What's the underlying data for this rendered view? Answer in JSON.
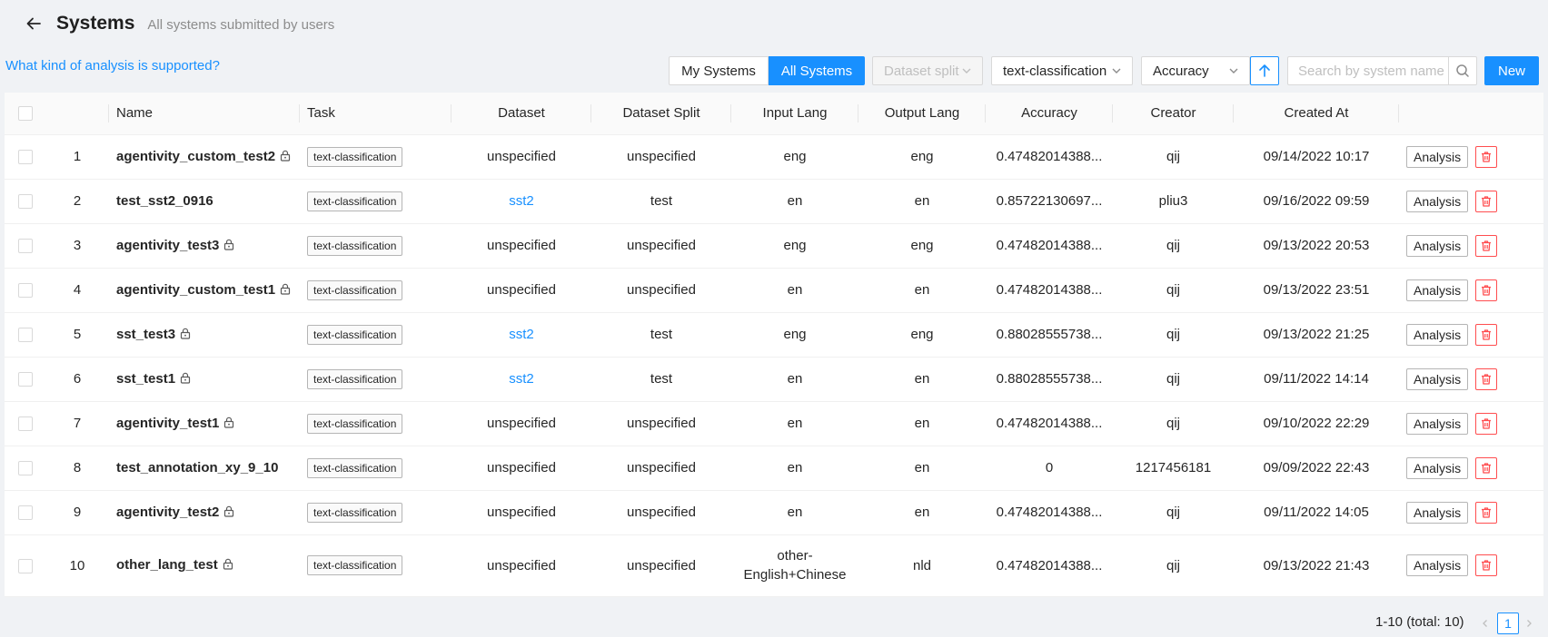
{
  "header": {
    "title": "Systems",
    "subtitle": "All systems submitted by users"
  },
  "help_link": "What kind of analysis is supported?",
  "toolbar": {
    "my_systems": "My Systems",
    "all_systems": "All Systems",
    "dataset_split_placeholder": "Dataset split",
    "task_value": "text-classification",
    "metric_value": "Accuracy",
    "search_placeholder": "Search by system name",
    "new_label": "New"
  },
  "table": {
    "columns": [
      "Name",
      "Task",
      "Dataset",
      "Dataset Split",
      "Input Lang",
      "Output Lang",
      "Accuracy",
      "Creator",
      "Created At"
    ],
    "rows": [
      {
        "index": "1",
        "name": "agentivity_custom_test2",
        "locked": true,
        "task": "text-classification",
        "dataset": "unspecified",
        "dataset_link": false,
        "split": "unspecified",
        "input_lang": "eng",
        "output_lang": "eng",
        "accuracy": "0.47482014388...",
        "creator": "qij",
        "created_at": "09/14/2022 10:17"
      },
      {
        "index": "2",
        "name": "test_sst2_0916",
        "locked": false,
        "task": "text-classification",
        "dataset": "sst2",
        "dataset_link": true,
        "split": "test",
        "input_lang": "en",
        "output_lang": "en",
        "accuracy": "0.85722130697...",
        "creator": "pliu3",
        "created_at": "09/16/2022 09:59"
      },
      {
        "index": "3",
        "name": "agentivity_test3",
        "locked": true,
        "task": "text-classification",
        "dataset": "unspecified",
        "dataset_link": false,
        "split": "unspecified",
        "input_lang": "eng",
        "output_lang": "eng",
        "accuracy": "0.47482014388...",
        "creator": "qij",
        "created_at": "09/13/2022 20:53"
      },
      {
        "index": "4",
        "name": "agentivity_custom_test1",
        "locked": true,
        "task": "text-classification",
        "dataset": "unspecified",
        "dataset_link": false,
        "split": "unspecified",
        "input_lang": "en",
        "output_lang": "en",
        "accuracy": "0.47482014388...",
        "creator": "qij",
        "created_at": "09/13/2022 23:51"
      },
      {
        "index": "5",
        "name": "sst_test3",
        "locked": true,
        "task": "text-classification",
        "dataset": "sst2",
        "dataset_link": true,
        "split": "test",
        "input_lang": "eng",
        "output_lang": "eng",
        "accuracy": "0.88028555738...",
        "creator": "qij",
        "created_at": "09/13/2022 21:25"
      },
      {
        "index": "6",
        "name": "sst_test1",
        "locked": true,
        "task": "text-classification",
        "dataset": "sst2",
        "dataset_link": true,
        "split": "test",
        "input_lang": "en",
        "output_lang": "en",
        "accuracy": "0.88028555738...",
        "creator": "qij",
        "created_at": "09/11/2022 14:14"
      },
      {
        "index": "7",
        "name": "agentivity_test1",
        "locked": true,
        "task": "text-classification",
        "dataset": "unspecified",
        "dataset_link": false,
        "split": "unspecified",
        "input_lang": "en",
        "output_lang": "en",
        "accuracy": "0.47482014388...",
        "creator": "qij",
        "created_at": "09/10/2022 22:29"
      },
      {
        "index": "8",
        "name": "test_annotation_xy_9_10",
        "locked": false,
        "task": "text-classification",
        "dataset": "unspecified",
        "dataset_link": false,
        "split": "unspecified",
        "input_lang": "en",
        "output_lang": "en",
        "accuracy": "0",
        "creator": "1217456181",
        "created_at": "09/09/2022 22:43"
      },
      {
        "index": "9",
        "name": "agentivity_test2",
        "locked": true,
        "task": "text-classification",
        "dataset": "unspecified",
        "dataset_link": false,
        "split": "unspecified",
        "input_lang": "en",
        "output_lang": "en",
        "accuracy": "0.47482014388...",
        "creator": "qij",
        "created_at": "09/11/2022 14:05"
      },
      {
        "index": "10",
        "name": "other_lang_test",
        "locked": true,
        "task": "text-classification",
        "dataset": "unspecified",
        "dataset_link": false,
        "split": "unspecified",
        "input_lang": "other-English+Chinese",
        "input_lang_lines": [
          "other-",
          "English+Chinese"
        ],
        "output_lang": "nld",
        "accuracy": "0.47482014388...",
        "creator": "qij",
        "created_at": "09/13/2022 21:43"
      }
    ],
    "analysis_label": "Analysis"
  },
  "pagination": {
    "total_text": "1-10 (total: 10)",
    "current_page": "1"
  },
  "colors": {
    "primary": "#1890ff",
    "danger": "#ff4d4f",
    "background": "#f0f2f5"
  }
}
